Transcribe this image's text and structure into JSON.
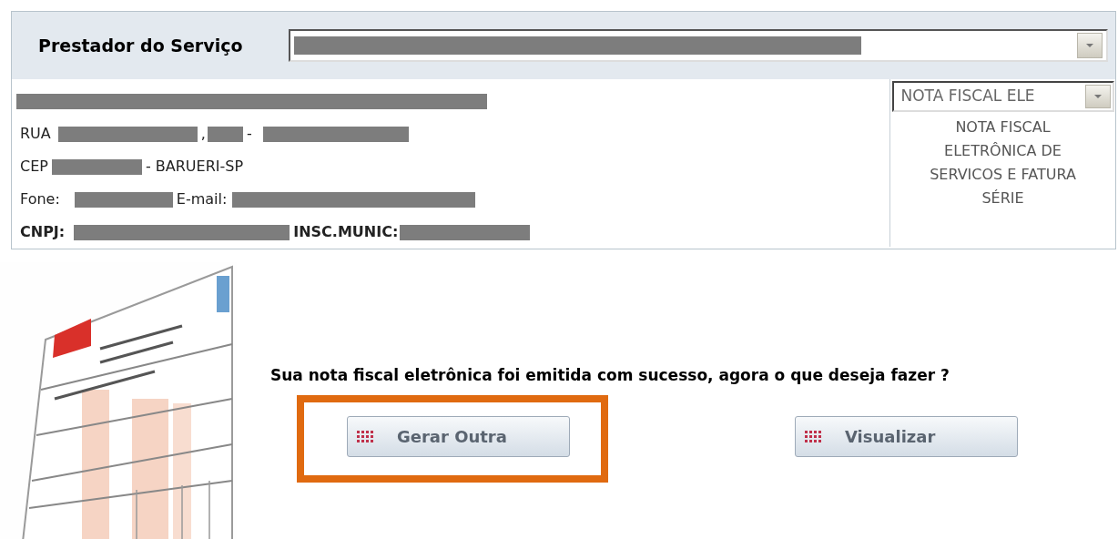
{
  "provider": {
    "label": "Prestador do Serviço",
    "select": {
      "kind": "redacted"
    }
  },
  "details": [
    {
      "parts": [
        {
          "kind": "redacted"
        }
      ]
    },
    {
      "parts": [
        {
          "kind": "text",
          "text": "RUA",
          "bold": false
        },
        {
          "kind": "redacted"
        },
        {
          "kind": "text",
          "text": ",",
          "bold": false
        },
        {
          "kind": "redacted"
        },
        {
          "kind": "text",
          "text": "-",
          "bold": false
        },
        {
          "kind": "redacted"
        }
      ]
    },
    {
      "parts": [
        {
          "kind": "text",
          "text": "CEP",
          "bold": false
        },
        {
          "kind": "redacted"
        },
        {
          "kind": "text",
          "text": "- BARUERI-SP",
          "bold": false
        }
      ]
    },
    {
      "parts": [
        {
          "kind": "text",
          "text": "Fone:",
          "bold": false
        },
        {
          "kind": "redacted"
        },
        {
          "kind": "text",
          "text": "E-mail:",
          "bold": false
        },
        {
          "kind": "redacted"
        }
      ]
    },
    {
      "parts": [
        {
          "kind": "text",
          "text": "CNPJ:",
          "bold": true
        },
        {
          "kind": "redacted"
        },
        {
          "kind": "text",
          "text": "INSC.MUNIC:",
          "bold": true
        },
        {
          "kind": "redacted"
        }
      ]
    }
  ],
  "document_type": {
    "select_value": "NOTA FISCAL ELE",
    "description": "NOTA FISCAL ELETRÔNICA DE SERVICOS E FATURA SÉRIE"
  },
  "message": "Sua nota fiscal eletrônica foi emitida com sucesso, agora o que deseja fazer ?",
  "buttons": [
    {
      "label": "Gerar Outra",
      "highlighted": true
    },
    {
      "label": "Visualizar",
      "highlighted": false
    }
  ]
}
